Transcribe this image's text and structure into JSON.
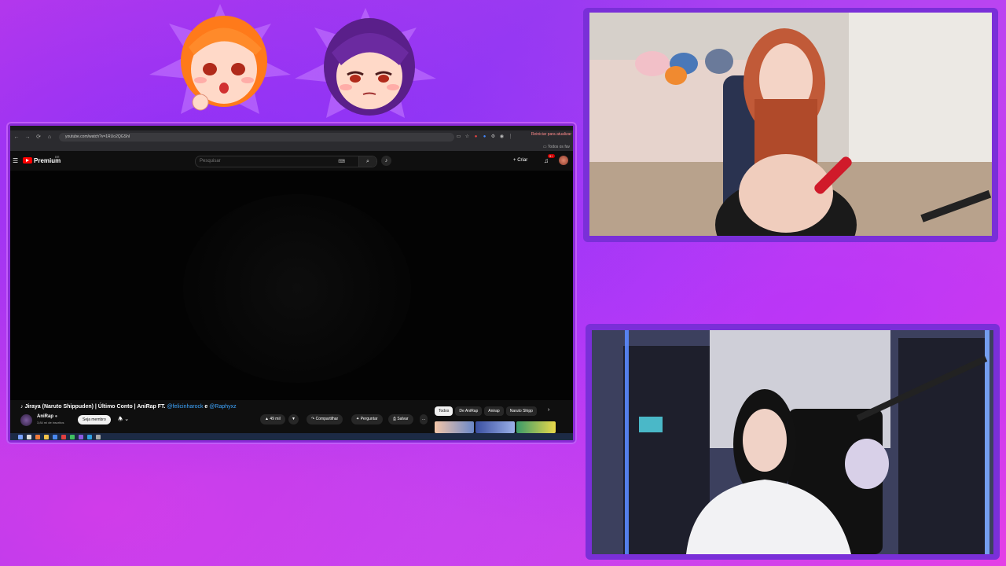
{
  "browser": {
    "url": "youtube.com/watch?v=1RUo2QGShI",
    "restart_label": "Reiniciar para atualizar",
    "bookmarks_label": "Todos os fav"
  },
  "youtube": {
    "logo_text": "Premium",
    "logo_region": "BR",
    "search_placeholder": "Pesquisar",
    "create_label": "Criar",
    "notification_count": "9+",
    "video_title": "♪ Jiraya (Naruto Shippuden) | Último Conto | AniRap FT.",
    "mention_1": "@felicinharock",
    "mention_joiner": "e",
    "mention_2": "@Raphyxz",
    "channel_name": "AniRap",
    "channel_subs": "3,84 mi de inscritos",
    "join_label": "Seja membro",
    "likes": "49 mil",
    "share_label": "Compartilhar",
    "ask_label": "Perguntar",
    "save_label": "Salvar",
    "more_label": "...",
    "chips": [
      "Todos",
      "De AniRap",
      "Anirap",
      "Naruto Shipp"
    ]
  },
  "icons": {
    "back": "←",
    "forward": "→",
    "reload": "⟳",
    "home": "⌂",
    "menu": "☰",
    "search": "⌕",
    "mic": "🎙",
    "bell": "🔔",
    "plus": "+",
    "like": "👍",
    "dislike": "👎",
    "share": "↷",
    "ask": "✦",
    "save": "⎙",
    "chevron_right": "›",
    "chevron_down": "⌄"
  },
  "colors": {
    "accent_frame": "#7a2fd8",
    "youtube_red": "#ff0000",
    "mention_blue": "#3ea6ff"
  }
}
